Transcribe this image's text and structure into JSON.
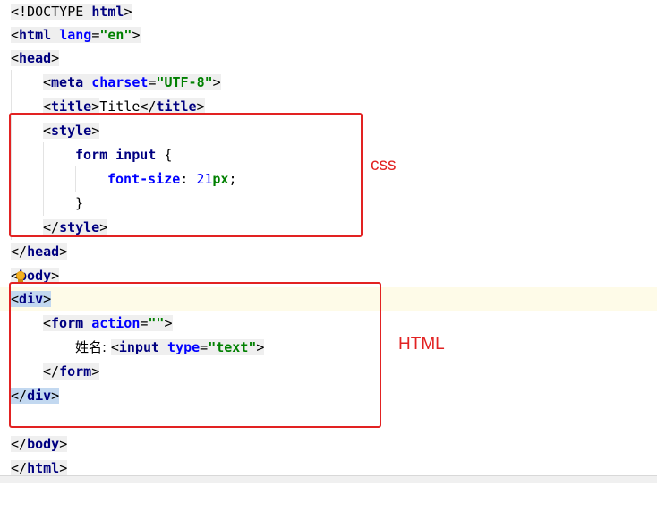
{
  "editor": {
    "lines": {
      "l1": {
        "open": "<!DOCTYPE ",
        "kw": "html",
        "close": ">"
      },
      "l2": {
        "open": "<",
        "kw": "html",
        "sp": " ",
        "attr": "lang",
        "eq": "=",
        "val": "\"en\"",
        "close": ">"
      },
      "l3": {
        "open": "<",
        "kw": "head",
        "close": ">"
      },
      "l4": {
        "open": "<",
        "kw": "meta",
        "sp": " ",
        "attr": "charset",
        "eq": "=",
        "val": "\"UTF-8\"",
        "close": ">"
      },
      "l5": {
        "open": "<",
        "kw": "title",
        "close": ">",
        "text": "Title",
        "open2": "</",
        "kw2": "title",
        "close2": ">"
      },
      "l6": {
        "open": "<",
        "kw": "style",
        "close": ">"
      },
      "l7": {
        "selector": "form input",
        "rest": " {"
      },
      "l8": {
        "prop": "font-size",
        "colon": ": ",
        "num": "21",
        "unit": "px",
        "semi": ";"
      },
      "l9": {
        "brace": "}"
      },
      "l10": {
        "open": "</",
        "kw": "style",
        "close": ">"
      },
      "l11": {
        "open": "</",
        "kw": "head",
        "close": ">"
      },
      "l12": {
        "open": "<",
        "kw": "body",
        "close": ">"
      },
      "l13": {
        "open": "<",
        "kw": "div",
        "close": ">"
      },
      "l14": {
        "open": "<",
        "kw": "form",
        "sp": " ",
        "attr": "action",
        "eq": "=",
        "val": "\"\"",
        "close": ">"
      },
      "l15": {
        "text": "姓名: ",
        "open": "<",
        "kw": "input",
        "sp": " ",
        "attr": "type",
        "eq": "=",
        "val": "\"text\"",
        "close": ">"
      },
      "l16": {
        "open": "</",
        "kw": "form",
        "close": ">"
      },
      "l17": {
        "open": "</",
        "kw": "div",
        "close": ">"
      },
      "l18": {
        "open": "</",
        "kw": "body",
        "close": ">"
      },
      "l19": {
        "open": "</",
        "kw": "html",
        "close": ">"
      }
    }
  },
  "annotations": {
    "css_label": "css",
    "html_label": "HTML"
  },
  "colors": {
    "annotation": "#e22222",
    "tag": "#000080",
    "attribute": "#0000ff",
    "string": "#008000",
    "current_line": "#fefbe8"
  }
}
